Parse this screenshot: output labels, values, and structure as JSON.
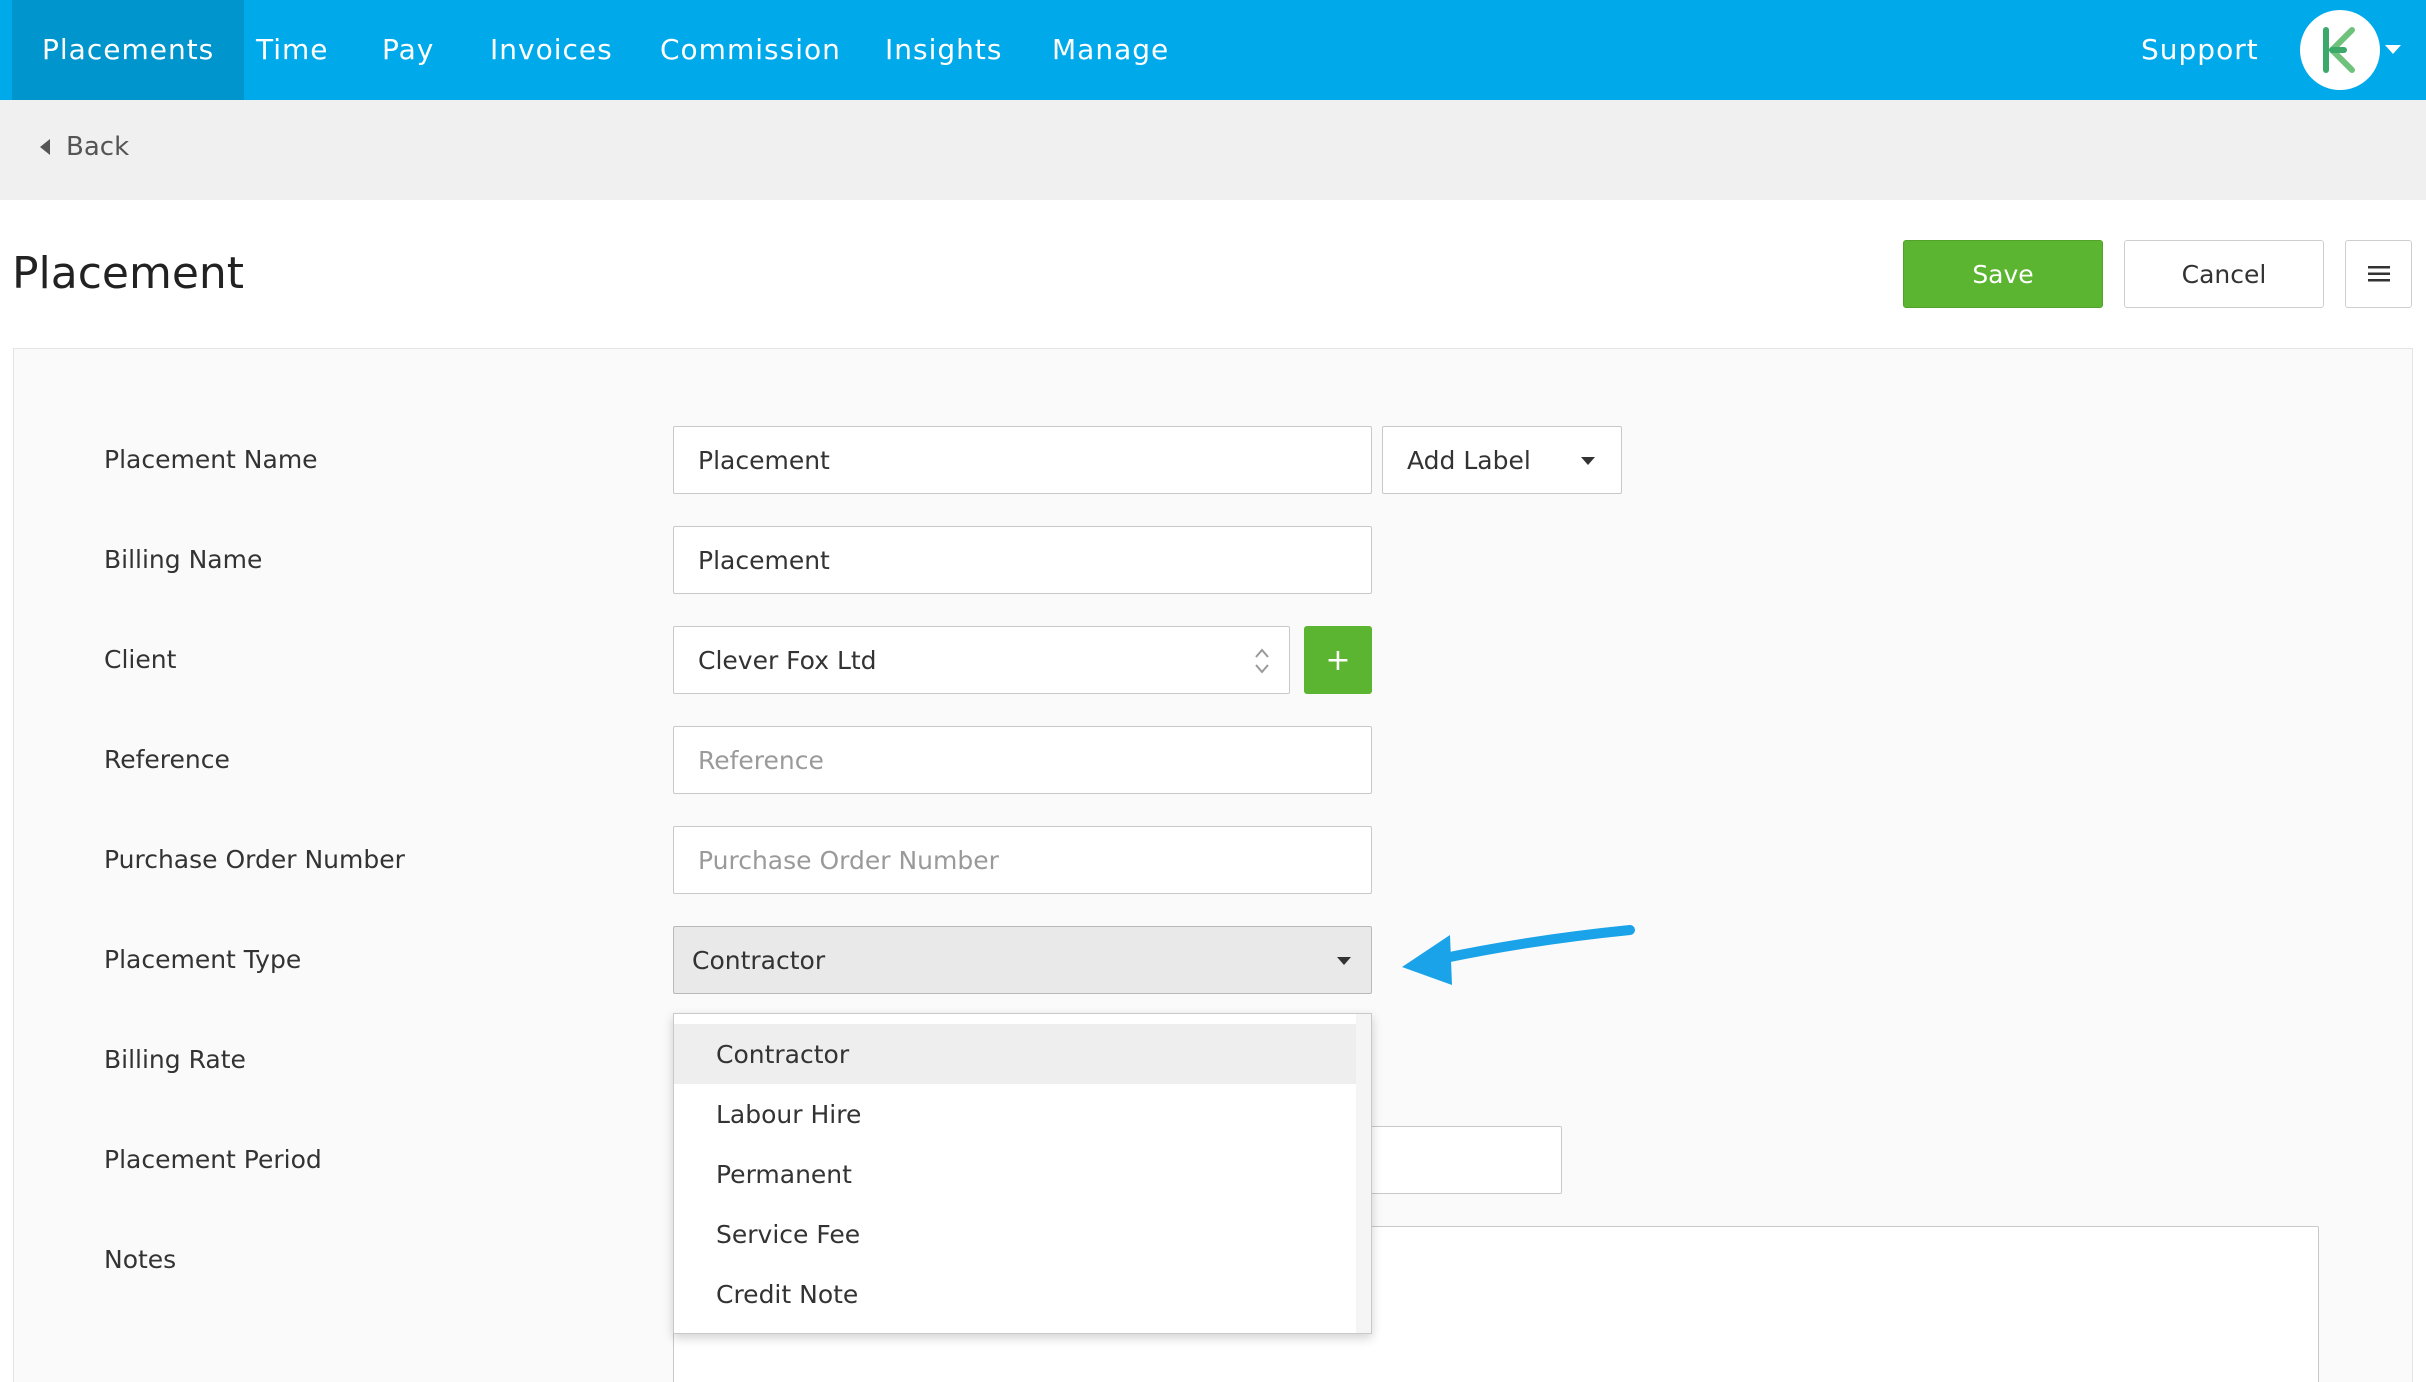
{
  "nav": {
    "items": [
      {
        "label": "Placements",
        "active": true
      },
      {
        "label": "Time"
      },
      {
        "label": "Pay"
      },
      {
        "label": "Invoices"
      },
      {
        "label": "Commission"
      },
      {
        "label": "Insights"
      },
      {
        "label": "Manage"
      }
    ],
    "support_label": "Support",
    "brand_color": "#00aaea",
    "avatar_icon": "k-logo-icon"
  },
  "back": {
    "label": "Back"
  },
  "page": {
    "title": "Placement"
  },
  "actions": {
    "save": "Save",
    "cancel": "Cancel",
    "menu_icon": "hamburger-icon"
  },
  "form": {
    "placement_name": {
      "label": "Placement Name",
      "value": "Placement"
    },
    "add_label": {
      "label": "Add Label"
    },
    "billing_name": {
      "label": "Billing Name",
      "value": "Placement"
    },
    "client": {
      "label": "Client",
      "value": "Clever Fox Ltd",
      "add_icon": "+"
    },
    "reference": {
      "label": "Reference",
      "placeholder": "Reference"
    },
    "purchase_order": {
      "label": "Purchase Order Number",
      "placeholder": "Purchase Order Number"
    },
    "placement_type": {
      "label": "Placement Type",
      "value": "Contractor",
      "options": [
        "Contractor",
        "Labour Hire",
        "Permanent",
        "Service Fee",
        "Credit Note"
      ],
      "selected_index": 0
    },
    "billing_rate": {
      "label": "Billing Rate"
    },
    "placement_period": {
      "label": "Placement Period"
    },
    "notes": {
      "label": "Notes"
    }
  },
  "colors": {
    "save": "#5cb531",
    "annotation_arrow": "#1aa3e8"
  }
}
